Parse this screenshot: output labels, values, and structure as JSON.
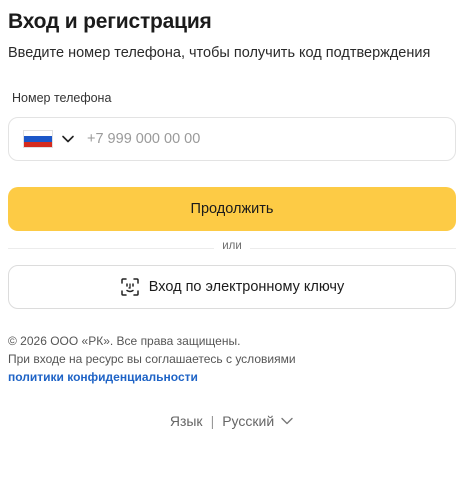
{
  "header": {
    "title": "Вход и регистрация",
    "subtitle": "Введите номер телефона, чтобы получить код подтверждения"
  },
  "phone": {
    "label": "Номер телефона",
    "placeholder": "+7 999 000 00 00",
    "country_icon": "russia-flag-icon",
    "flag_colors": [
      "#ffffff",
      "#1c57c8",
      "#d52b1e"
    ]
  },
  "actions": {
    "continue_label": "Продолжить",
    "divider_text": "или",
    "key_login_label": "Вход по электронному ключу",
    "key_login_icon": "face-id-icon"
  },
  "footer": {
    "copyright": "© 2026 ООО «РК». Все права защищены.",
    "terms_text": "При входе на ресурс вы соглашаетесь с условиями",
    "privacy_link": "политики конфиденциальности"
  },
  "language": {
    "label": "Язык",
    "current": "Русский"
  },
  "colors": {
    "accent": "#fdcb45",
    "link": "#1e63c6"
  }
}
